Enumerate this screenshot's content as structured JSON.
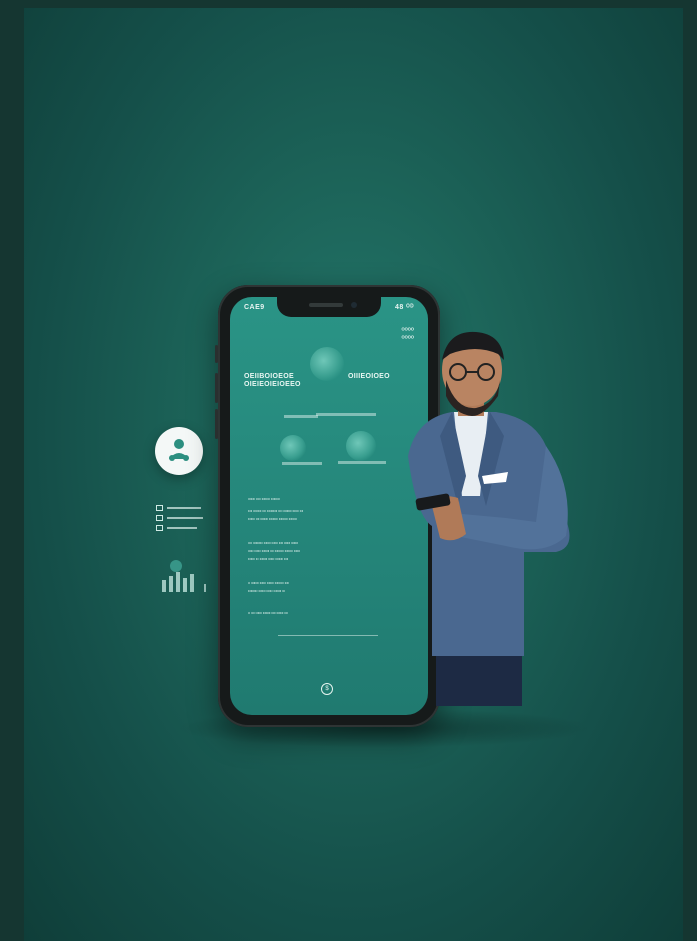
{
  "colors": {
    "background": "#1c6358",
    "screen": "#2a9486",
    "phone_frame": "#161a1a",
    "jacket": "#4a6890",
    "text_on_screen": "#e8f5f2"
  },
  "phone": {
    "status_left": "CAE9",
    "status_right": "48 ᴼᴰ",
    "corner_label": "ᴼᴼᴼᴼ ᴼᴼᴼᴼ",
    "heading_left": "OEIIBOIOEOE OIEIEOIEIOEEO",
    "heading_right": "OIIIEOIOEO",
    "section_lines": [
      "ᴼᴵᴵᴼᴵᴵ ᴼᴼᴵ ᴵᴼᴵᴵᴼᴼ ᴵᴼᴵᴵᴼᴼᴵ",
      "ᴵᴼᴵᴵ ᴼᴵᴼᴵᴼᴵ ᴵᴼᴵ ᴵᴼᴼᴵᴵᴵᴼᴵᴵ ᴵᴼᴵ ᴼᴼᴵᴵᴵᴼᴵ ᴵᴵᴼᴼᴵ ᴵᴼᴵ",
      "ᴵᴼᴵᴵᴵᴼ ᴼᴵᴵ ᴵᴼᴵᴵᴼᴵᴵ ᴵᴼᴼᴵᴵᴼᴵ ᴵᴼᴵᴵᴼᴼᴵ ᴵᴼᴵᴵᴼᴼ",
      "ᴼᴼ ᴵᴼᴵᴵᴼᴵᴵᴼ ᴵᴼᴵᴵᴼᴵ ᴵᴼᴵᴵᴼ ᴵᴼᴵᴵ ᴼᴵᴵᴼᴵ ᴵᴼᴵᴵᴼᴵ",
      "ᴼᴵᴵᴼ ᴵᴼᴵᴵᴼ ᴵᴼᴵᴵᴼᴵᴵ ᴵᴼᴵ ᴵᴼᴵᴵᴼᴼᴵ ᴵᴼᴵᴵᴼᴼ ᴵᴼᴵᴵᴼ",
      "ᴵᴼᴵᴵᴼᴵ ᴵᴼ ᴵᴼᴵᴵᴼᴵᴵ ᴵᴼᴵᴵᴼ ᴵᴼᴵᴵᴼᴵᴵ ᴵᴼᴵᴵ",
      "ᴼ ᴵᴼᴵᴵᴼᴵᴵ ᴵᴼᴵᴵᴼ ᴵᴼᴵᴵᴼᴵ ᴵᴼᴵᴵᴼᴼᴵ ᴵᴼᴵᴵ",
      "ᴵᴼᴵᴵᴼᴵᴵᴼ ᴵᴼᴵᴵᴼᴵ ᴵᴼᴵᴵᴼ ᴵᴼᴵᴵᴼᴵᴵ ᴵᴼ",
      "ᴼ ᴵᴼᴵ ᴼᴵᴵᴼᴵ ᴵᴼᴵᴵᴼᴵᴵ ᴵᴼᴵᴵ ᴵᴼᴵᴵᴼᴵ ᴵᴼᴵ"
    ],
    "home_icon": "$"
  },
  "badge_icon": "app-logo-icon"
}
